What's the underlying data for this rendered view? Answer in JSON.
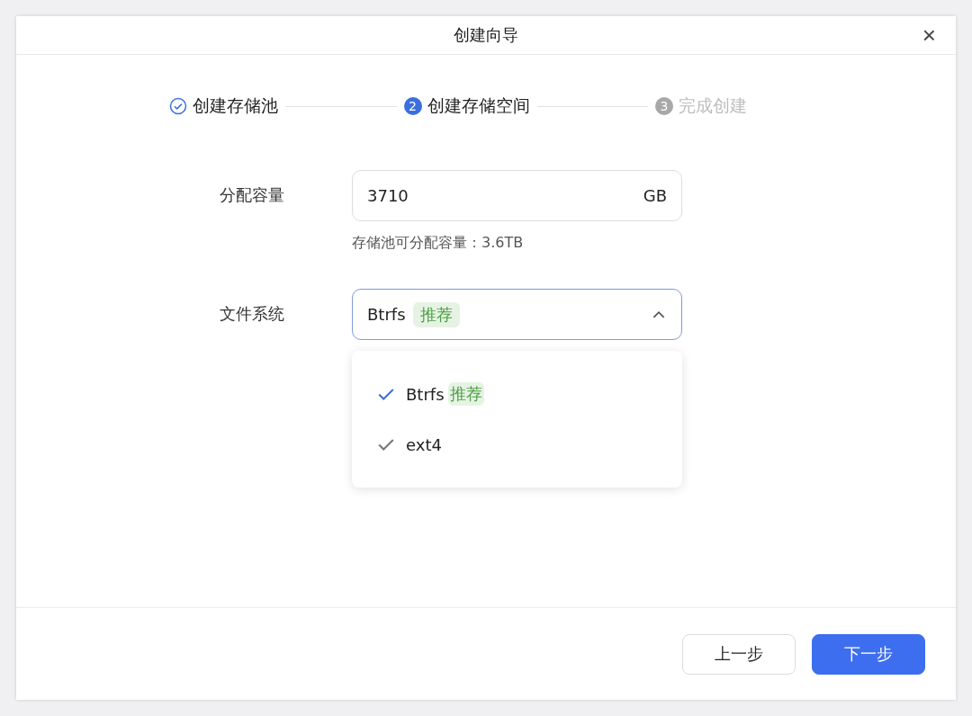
{
  "dialog": {
    "title": "创建向导",
    "close": "×"
  },
  "steps": [
    {
      "label": "创建存储池",
      "kind": "done"
    },
    {
      "label": "创建存储空间",
      "kind": "current",
      "number": "2"
    },
    {
      "label": "完成创建",
      "kind": "pending",
      "number": "3"
    }
  ],
  "capacity": {
    "label": "分配容量",
    "value": "3710",
    "unit": "GB",
    "hint": "存储池可分配容量：3.6TB"
  },
  "filesystem": {
    "label": "文件系统",
    "value": "Btrfs",
    "tag": "推荐",
    "expanded": true,
    "options": [
      {
        "label": "Btrfs",
        "tag": "推荐",
        "selected": true
      },
      {
        "label": "ext4",
        "selected": false
      }
    ]
  },
  "buttons": [
    {
      "label": "上一步",
      "kind": "secondary"
    },
    {
      "label": "下一步",
      "kind": "primary"
    }
  ]
}
